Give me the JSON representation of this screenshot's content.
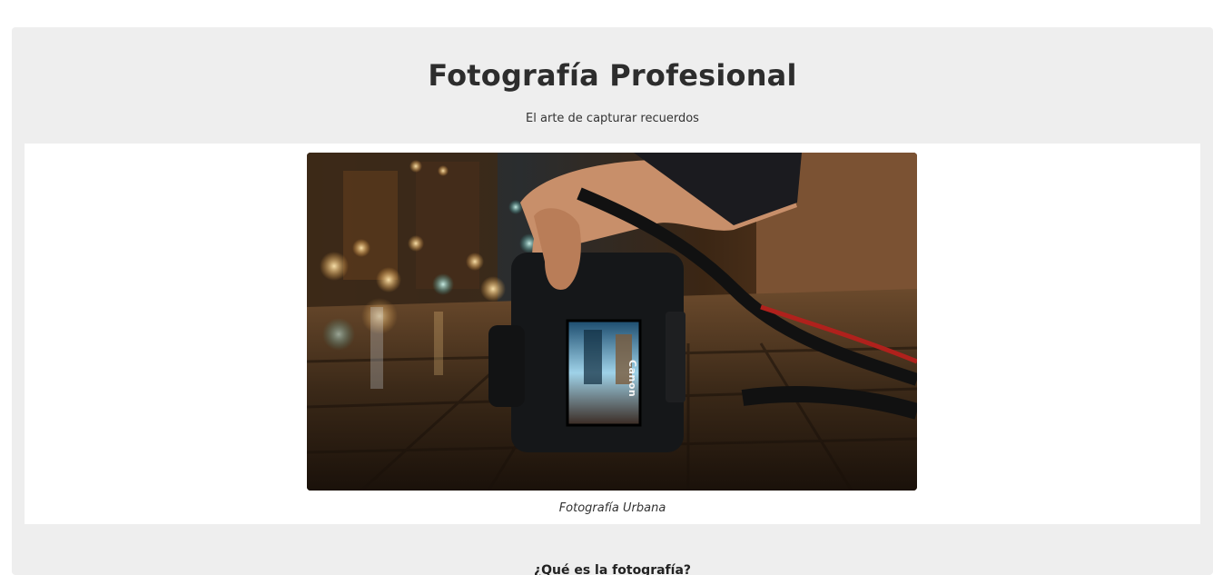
{
  "header": {
    "title": "Fotografía Profesional",
    "subtitle": "El arte de capturar recuerdos"
  },
  "figure": {
    "image_subject": "camera-on-city-street-photo",
    "camera_screen_brand": "Canon",
    "caption": "Fotografía Urbana"
  },
  "section": {
    "heading": "¿Qué es la fotografía?"
  },
  "colors": {
    "page_background": "#ffffff",
    "panel_background": "#eeeeee",
    "figure_background": "#ffffff",
    "text": "#2b2b2b"
  }
}
